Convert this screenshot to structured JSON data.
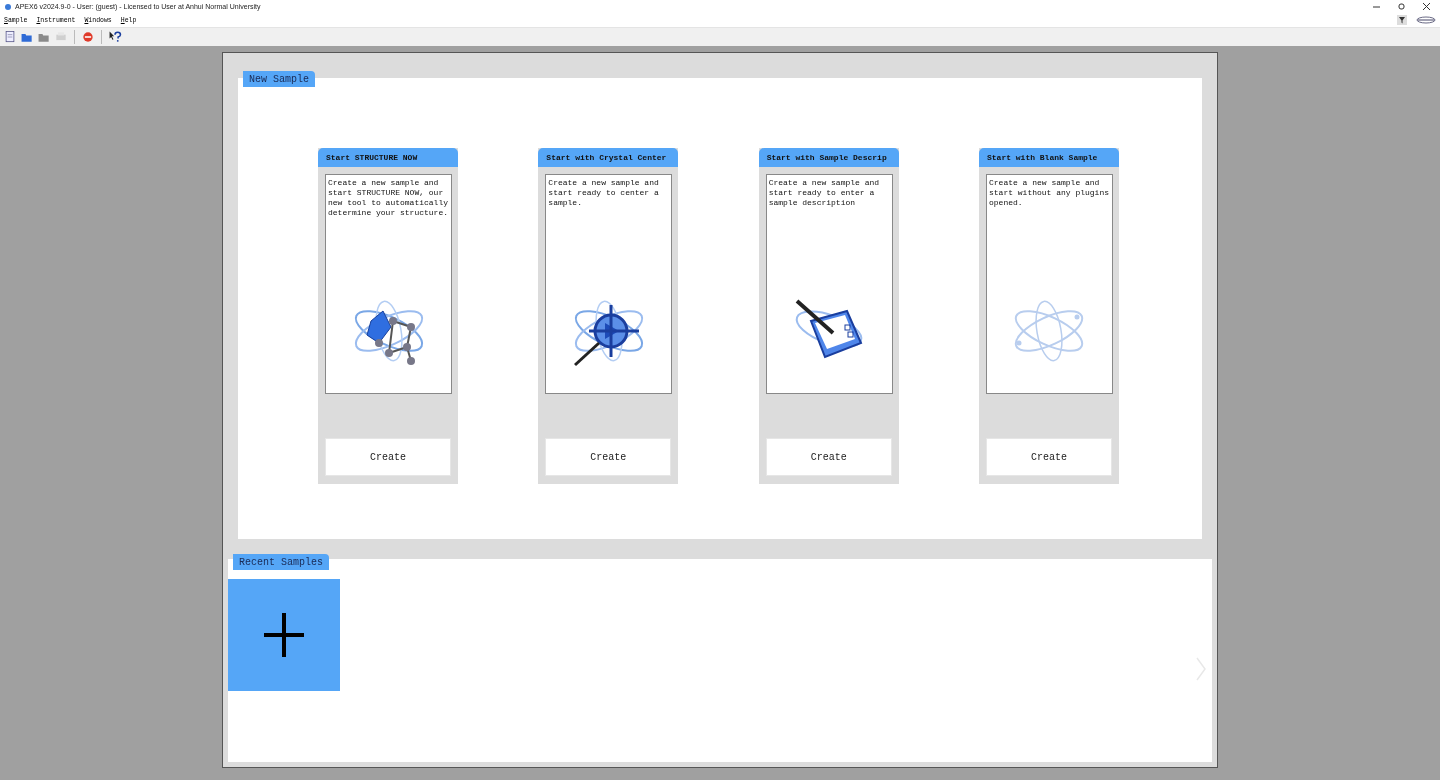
{
  "window": {
    "title": "APEX6 v2024.9-0 - User: (guest) - Licensed to User at Anhui Normal University"
  },
  "menu": [
    "Sample",
    "Instrument",
    "Windows",
    "Help"
  ],
  "toolbar": [
    {
      "kind": "new",
      "disabled": false
    },
    {
      "kind": "open",
      "disabled": false
    },
    {
      "kind": "folder",
      "disabled": false
    },
    {
      "kind": "print",
      "disabled": true
    },
    {
      "kind": "stop",
      "disabled": false
    },
    {
      "kind": "help",
      "disabled": false
    }
  ],
  "new_sample": {
    "title": "New Sample",
    "cards": [
      {
        "kind": "structure",
        "title": "Start STRUCTURE NOW",
        "description": "Create a new sample and start STRUCTURE NOW, our new tool to automatically determine your structure.",
        "button": "Create"
      },
      {
        "kind": "crystal",
        "title": "Start with Crystal Center",
        "description": "Create a new sample and start ready to center a sample.",
        "button": "Create"
      },
      {
        "kind": "description",
        "title": "Start with Sample Descrip",
        "description": "Create a new sample and start ready to enter a sample description",
        "button": "Create"
      },
      {
        "kind": "blank",
        "title": "Start with Blank Sample",
        "description": "Create a new sample and start without any plugins opened.",
        "button": "Create"
      }
    ]
  },
  "recent_samples": {
    "title": "Recent Samples"
  }
}
